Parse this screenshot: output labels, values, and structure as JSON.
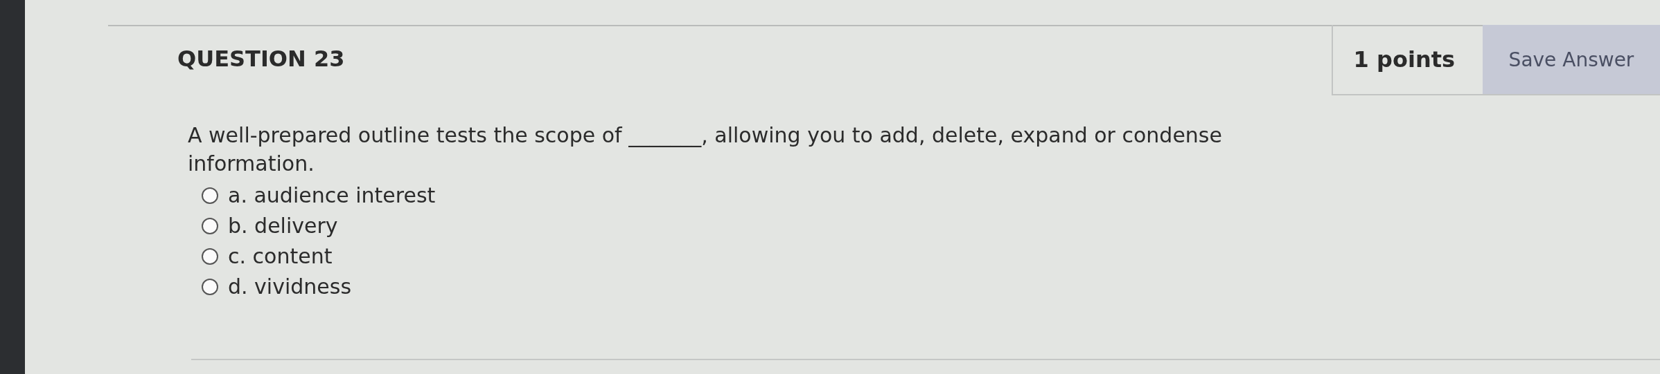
{
  "question": {
    "title": "QUESTION 23",
    "points": "1 points",
    "save_button": "Save Answer",
    "text": "A well-prepared outline tests the scope of _______, allowing you to add, delete, expand or condense information.",
    "options": [
      {
        "label": "a. audience interest",
        "selected": false
      },
      {
        "label": "b. delivery",
        "selected": false
      },
      {
        "label": "c. content",
        "selected": false
      },
      {
        "label": "d. vividness",
        "selected": false
      }
    ]
  }
}
